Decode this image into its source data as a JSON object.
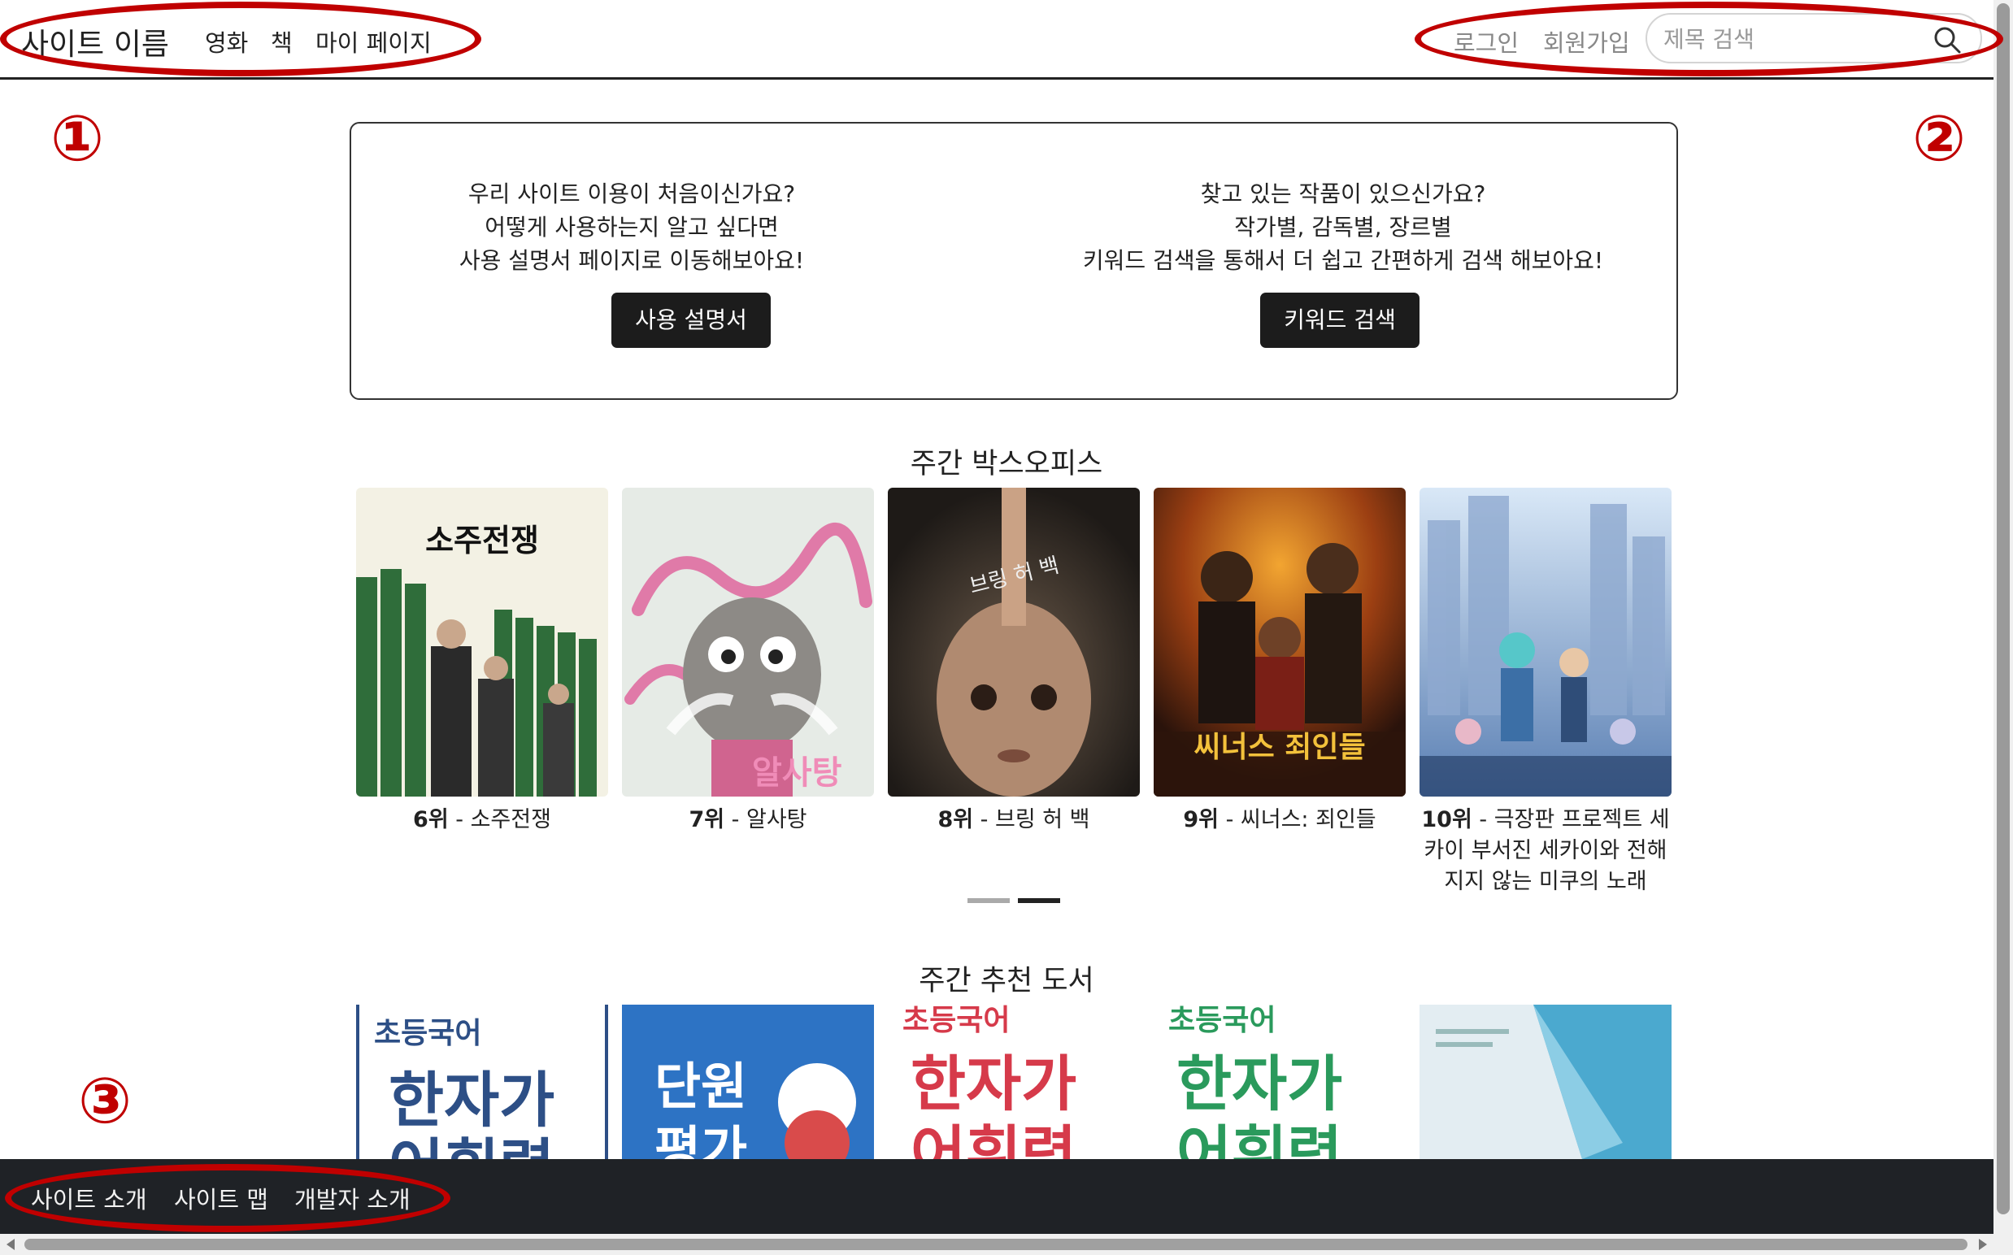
{
  "header": {
    "brand": "사이트 이름",
    "nav": [
      "영화",
      "책",
      "마이 페이지"
    ],
    "login": "로그인",
    "signup": "회원가입",
    "search_placeholder": "제목 검색"
  },
  "annotations": [
    "①",
    "②",
    "③"
  ],
  "intro": {
    "left_lines": [
      "우리 사이트 이용이 처음이신가요?",
      "어떻게 사용하는지 알고 싶다면",
      "사용 설명서 페이지로 이동해보아요!"
    ],
    "left_button": "사용 설명서",
    "right_lines": [
      "찾고 있는 작품이 있으신가요?",
      "작가별, 감독별, 장르별",
      "키워드 검색을 통해서 더 쉽고 간편하게 검색 해보아요!"
    ],
    "right_button": "키워드 검색"
  },
  "box_office": {
    "title": "주간 박스오피스",
    "items": [
      {
        "rank": "6위",
        "title": " - 소주전쟁",
        "poster_text": "소주전쟁"
      },
      {
        "rank": "7위",
        "title": " - 알사탕",
        "poster_text": "알사탕"
      },
      {
        "rank": "8위",
        "title": " - 브링 허 백",
        "poster_text": "브링 허 백"
      },
      {
        "rank": "9위",
        "title": " - 씨너스: 죄인들",
        "poster_text": "씨너스 죄인들"
      },
      {
        "rank": "10위",
        "title": " - 극장판 프로젝트 세카이 부서진 세카이와 전해지지 않는 미쿠의 노래",
        "poster_text": ""
      }
    ]
  },
  "books": {
    "title": "주간 추천 도서",
    "covers": [
      {
        "top": "초등국어",
        "big": "한자가",
        "bottom": "어휘력"
      },
      {
        "top": "",
        "big": "단원",
        "bottom": "평가"
      },
      {
        "top": "초등국어",
        "big": "한자가",
        "bottom": "어휘력"
      },
      {
        "top": "초등국어",
        "big": "한자가",
        "bottom": "어휘력"
      },
      {
        "top": "",
        "big": "",
        "bottom": ""
      }
    ]
  },
  "footer": {
    "links": [
      "사이트 소개",
      "사이트 맵",
      "개발자 소개"
    ]
  },
  "colors": {
    "annotation": "#c00000",
    "footer_bg": "#1f2226",
    "button_bg": "#1c1c1c"
  }
}
